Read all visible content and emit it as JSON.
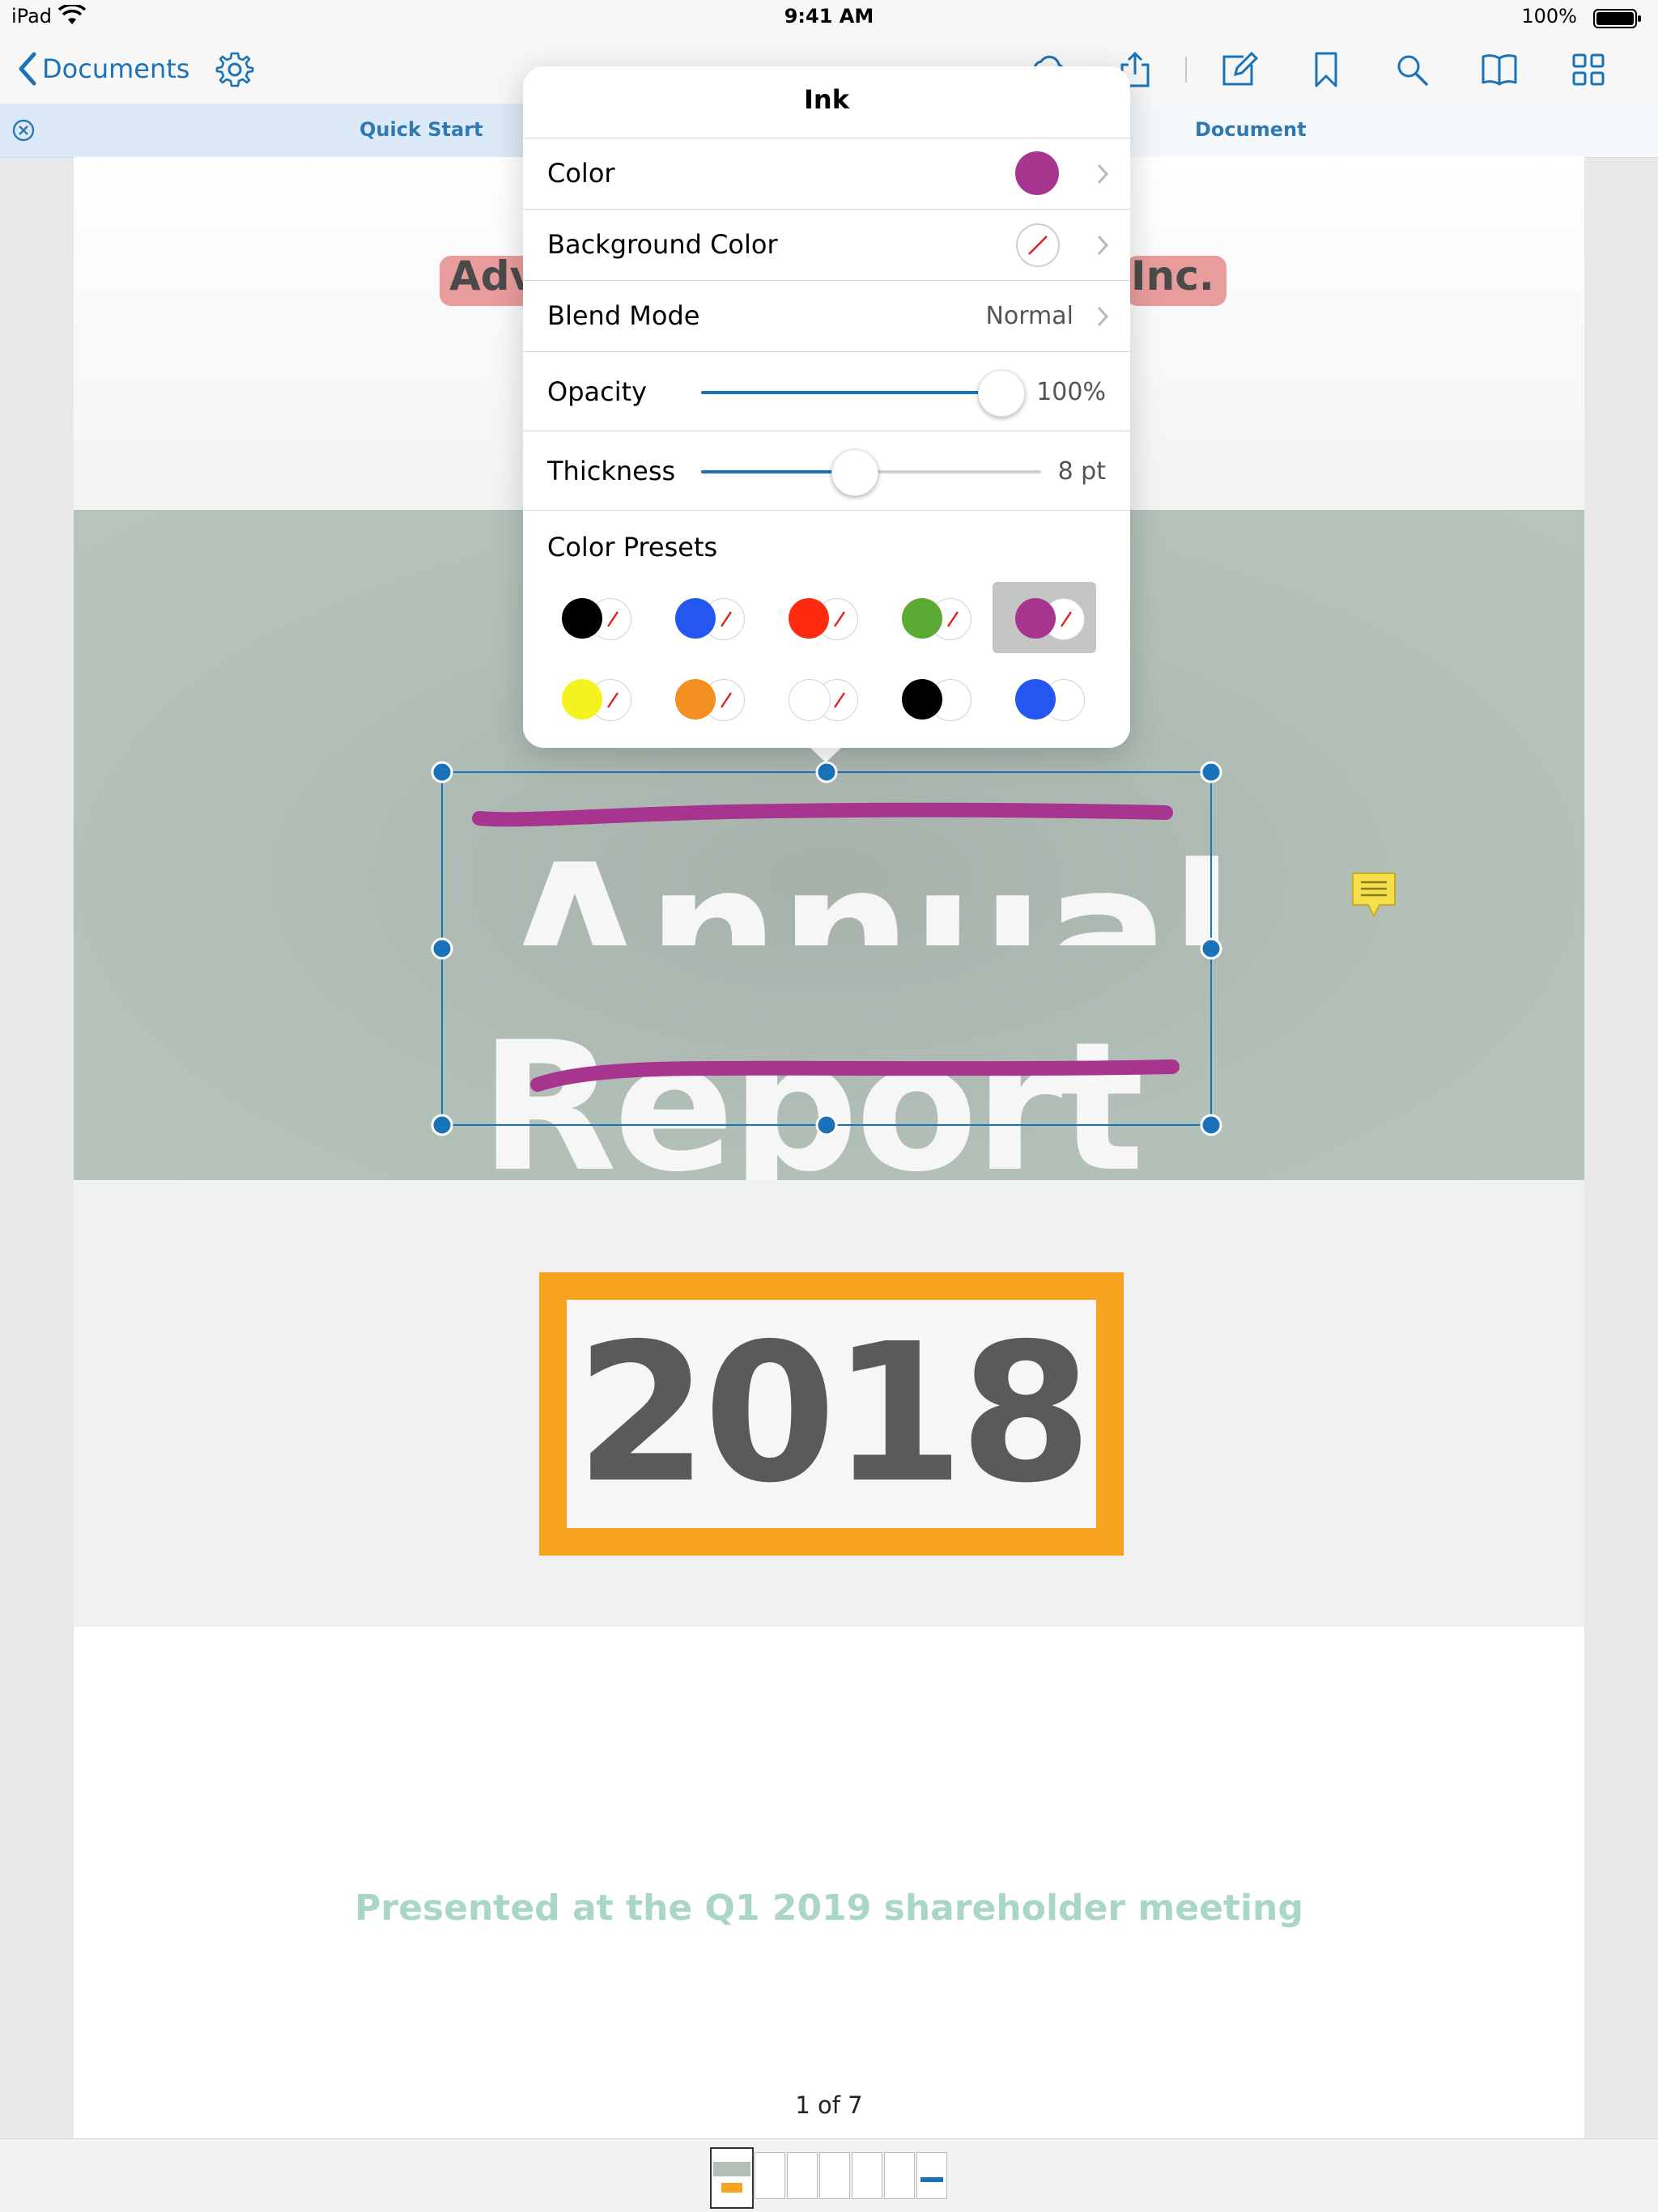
{
  "status_bar": {
    "device": "iPad",
    "time": "9:41 AM",
    "battery": "100%"
  },
  "nav": {
    "back_label": "Documents"
  },
  "tabs": [
    {
      "label": "Quick Start"
    },
    {
      "label": "Document"
    }
  ],
  "document": {
    "company_left": "Adv",
    "company_right": "Inc.",
    "title_line1": "Annual",
    "title_line2": "Report",
    "year": "2018",
    "subtitle": "Presented at the Q1 2019 shareholder meeting"
  },
  "page_indicator": "1 of 7",
  "popover": {
    "title": "Ink",
    "color_label": "Color",
    "background_color_label": "Background Color",
    "blend_mode_label": "Blend Mode",
    "blend_mode_value": "Normal",
    "opacity_label": "Opacity",
    "opacity_value": "100%",
    "opacity_level": 1.0,
    "thickness_label": "Thickness",
    "thickness_value": "8 pt",
    "thickness_level": 0.45,
    "color_presets_label": "Color Presets",
    "current_color": "#a7358f",
    "presets": [
      {
        "color": "#000000",
        "background": "none",
        "selected": false
      },
      {
        "color": "#2456f0",
        "background": "none",
        "selected": false
      },
      {
        "color": "#ff2a0f",
        "background": "none",
        "selected": false
      },
      {
        "color": "#5aaa33",
        "background": "none",
        "selected": false
      },
      {
        "color": "#a7358f",
        "background": "none",
        "selected": true
      },
      {
        "color": "#f4f31f",
        "background": "none",
        "selected": false
      },
      {
        "color": "#f39021",
        "background": "none",
        "selected": false
      },
      {
        "color": "#ffffff",
        "background": "none",
        "selected": false
      },
      {
        "color": "#000000",
        "background": "#ffffff",
        "selected": false
      },
      {
        "color": "#2456f0",
        "background": "#ffffff",
        "selected": false
      }
    ]
  },
  "colors": {
    "accent": "#1a73b8",
    "ink": "#a7358f",
    "year_frame": "#f6a31f",
    "note": "#f5e04a"
  }
}
